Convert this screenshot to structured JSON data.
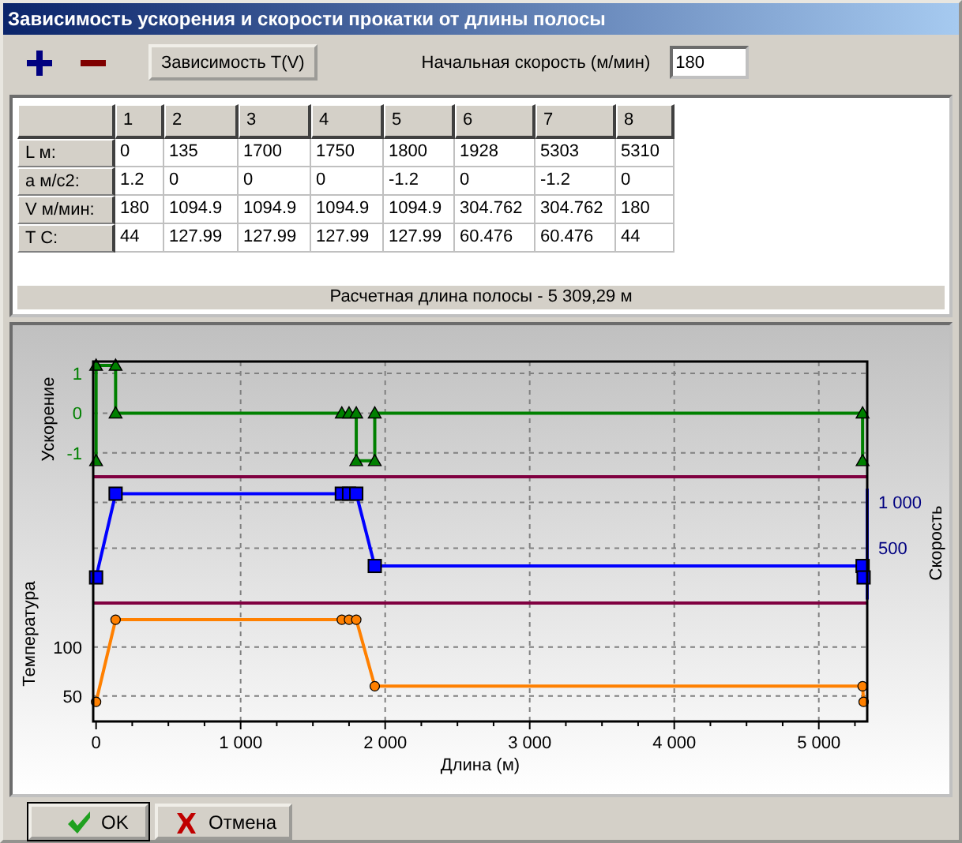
{
  "window": {
    "title": "Зависимость ускорения и скорости прокатки  от длины полосы"
  },
  "toolbar": {
    "button": "Зависимость T(V)",
    "speed_label": "Начальная скорость (м/мин)",
    "speed_value": "180"
  },
  "table": {
    "columns": [
      "1",
      "2",
      "3",
      "4",
      "5",
      "6",
      "7",
      "8"
    ],
    "rows": [
      {
        "label": "L м:",
        "cells": [
          "0",
          "135",
          "1700",
          "1750",
          "1800",
          "1928",
          "5303",
          "5310"
        ]
      },
      {
        "label": "a м/c2:",
        "cells": [
          "1.2",
          "0",
          "0",
          "0",
          "-1.2",
          "0",
          "-1.2",
          "0"
        ]
      },
      {
        "label": "V м/мин:",
        "cells": [
          "180",
          "1094.9",
          "1094.9",
          "1094.9",
          "1094.9",
          "304.762",
          "304.762",
          "180"
        ]
      },
      {
        "label": "T C:",
        "cells": [
          "44",
          "127.99",
          "127.99",
          "127.99",
          "127.99",
          "60.476",
          "60.476",
          "44"
        ]
      }
    ],
    "summary": "Расчетная длина полосы - 5 309,29 м"
  },
  "chart": {
    "panes": [
      {
        "chart_data": {
          "type": "line",
          "grid": true,
          "ylabel": "Ускорение",
          "x": [
            0,
            0,
            135,
            135,
            1700,
            1750,
            1800,
            1800,
            1928,
            1928,
            5303,
            5303
          ],
          "xlim": [
            -20,
            5335
          ],
          "ylim": [
            -1.6,
            1.3
          ],
          "yticks": [
            -1,
            0,
            1
          ],
          "series": [
            {
              "color": "#008000",
              "marker": "triangle",
              "values": [
                -1.2,
                1.2,
                1.2,
                0,
                0,
                0,
                0,
                -1.2,
                -1.2,
                0,
                0,
                -1.2
              ]
            }
          ]
        }
      },
      {
        "chart_data": {
          "type": "line",
          "grid": true,
          "ylabel": "Скорость",
          "x": [
            0,
            135,
            1700,
            1750,
            1800,
            1928,
            5303,
            5310
          ],
          "xlim": [
            -20,
            5335
          ],
          "ylim": [
            -100,
            1280
          ],
          "yticks": [
            500,
            {
              "value": 1000,
              "label": "1 000"
            }
          ],
          "series": [
            {
              "color": "#0000ff",
              "marker": "square",
              "values": [
                180,
                1095,
                1095,
                1095,
                1095,
                305,
                305,
                180
              ]
            }
          ]
        }
      },
      {
        "chart_data": {
          "type": "line",
          "grid": true,
          "ylabel": "Температура",
          "xlabel": "Длина (м)",
          "x": [
            0,
            135,
            1700,
            1750,
            1800,
            1928,
            5303,
            5310
          ],
          "xlim": [
            -20,
            5335
          ],
          "ylim": [
            24,
            145
          ],
          "yticks": [
            50,
            100
          ],
          "xticks": [
            0,
            {
              "value": 1000,
              "label": "1 000"
            },
            {
              "value": 2000,
              "label": "2 000"
            },
            {
              "value": 3000,
              "label": "3 000"
            },
            {
              "value": 4000,
              "label": "4 000"
            },
            {
              "value": 5000,
              "label": "5 000"
            }
          ],
          "series": [
            {
              "color": "#ff8000",
              "marker": "circle",
              "values": [
                44,
                128,
                128,
                128,
                128,
                60,
                60,
                44
              ]
            }
          ]
        }
      }
    ]
  },
  "buttons": [
    {
      "label": "OK",
      "kind": "ok"
    },
    {
      "label": "Отмена",
      "kind": "cancel"
    }
  ]
}
